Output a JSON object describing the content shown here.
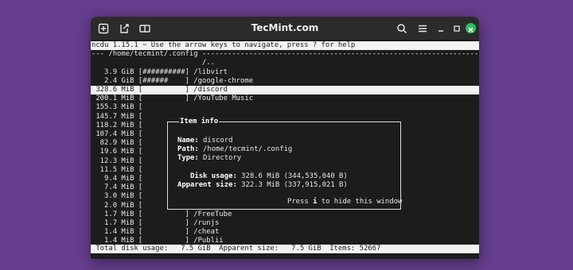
{
  "window": {
    "title": "TecMint.com",
    "icons": [
      "new-tab-icon",
      "share-icon",
      "layout-icon",
      "search-icon",
      "menu-icon",
      "minimize-icon",
      "maximize-icon",
      "close-icon"
    ]
  },
  "ncdu": {
    "header": "ncdu 1.15.1 ~ Use the arrow keys to navigate, press ? for help",
    "path_line": "--- /home/tecmint/.config -----------------------------------------------------------------",
    "parent": "                          /..",
    "rows": [
      "   3.9 GiB [##########] /libvirt",
      "   2.4 GiB [######    ] /google-chrome",
      " 328.6 MiB [          ] /discord",
      " 200.1 MiB [          ] /YouTube Music",
      " 155.3 MiB [",
      " 145.7 MiB [",
      " 118.2 MiB [",
      " 107.4 MiB [",
      "  82.9 MiB [",
      "  19.6 MiB [",
      "  12.3 MiB [",
      "  11.5 MiB [",
      "   9.4 MiB [",
      "   7.4 MiB [",
      "   3.0 MiB [",
      "   2.0 MiB [          ] /obsidian",
      "   1.7 MiB [          ] /FreeTube",
      "   1.7 MiB [          ] /runjs",
      "   1.4 MiB [          ] /cheat",
      "   1.4 MiB [          ] /Publii"
    ],
    "footer": " Total disk usage:   7.5 GiB  Apparent size:   7.5 GiB  Items: 52667"
  },
  "item_info": {
    "title": "Item info",
    "name_label": "Name:",
    "name_value": " discord",
    "path_label": "Path:",
    "path_value": " /home/tecmint/.config",
    "type_label": "Type:",
    "type_value": " Directory",
    "disk_label": "   Disk usage:",
    "disk_value": " 328.6 MiB (344,535,040 B)",
    "apparent_label": "Apparent size:",
    "apparent_value": " 322.3 MiB (337,915,021 B)",
    "hint_pre": "Press ",
    "hint_key": "i",
    "hint_post": " to hide this window"
  }
}
